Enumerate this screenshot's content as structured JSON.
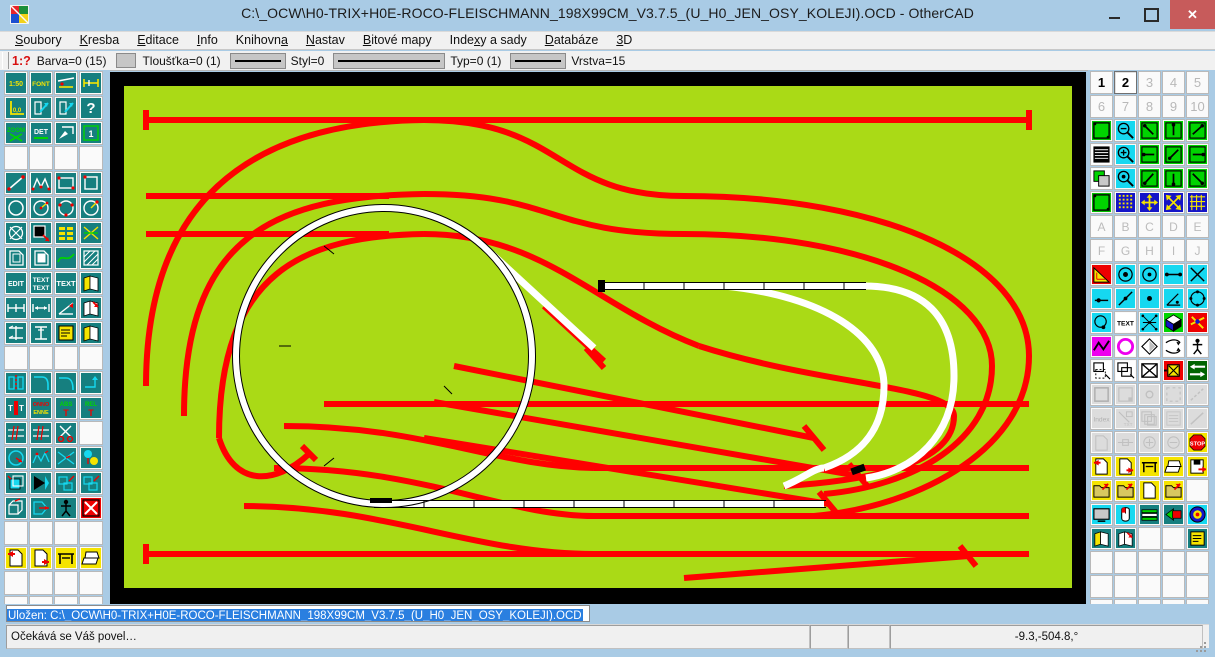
{
  "window": {
    "title": "C:\\_OCW\\H0-TRIX+H0E-ROCO-FLEISCHMANN_198X99CM_V3.7.5_(U_H0_JEN_OSY_KOLEJI).OCD - OtherCAD",
    "logo_icon": "othercad-logo-icon",
    "minimize_label": "–",
    "maximize_label": "□",
    "close_label": "✕"
  },
  "menu": {
    "items": [
      {
        "label": "Soubory",
        "mnemonic": "S"
      },
      {
        "label": "Kresba",
        "mnemonic": "K"
      },
      {
        "label": "Editace",
        "mnemonic": "E"
      },
      {
        "label": "Info",
        "mnemonic": "I"
      },
      {
        "label": "Knihovna",
        "mnemonic": "a"
      },
      {
        "label": "Nastav",
        "mnemonic": "N"
      },
      {
        "label": "Bitové mapy",
        "mnemonic": "B"
      },
      {
        "label": "Indexy a sady",
        "mnemonic": "x"
      },
      {
        "label": "Databáze",
        "mnemonic": "D"
      },
      {
        "label": "3D",
        "mnemonic": "3"
      }
    ]
  },
  "properties": {
    "ratio": "1:?",
    "color": "Barva=0 (15)",
    "color_swatch": "#c6c6c6",
    "thickness": "Tloušťka=0 (1)",
    "style": "Styl=0",
    "type": "Typ=0 (1)",
    "layer": "Vrstva=15"
  },
  "left_toolbar": {
    "rows": [
      [
        "scale-1-50-icon",
        "font-icon",
        "dimension-slope-icon",
        "dimension-linear-icon"
      ],
      [
        "origin-0-0-icon",
        "query-arrow-icon",
        "query-arrow-alt-icon",
        "question-mark-icon"
      ],
      [
        "zoom-icon",
        "detail-icon",
        "pick-entity-icon",
        "layer-1-icon"
      ],
      [
        "",
        "",
        "",
        ""
      ],
      [
        "line-icon",
        "polyline-icon",
        "rectangle-icon",
        "square-icon"
      ],
      [
        "circle-icon",
        "circle-radius-icon",
        "arc-3point-icon",
        "arc-center-icon"
      ],
      [
        "ellipse-icon",
        "filled-shape-icon",
        "table-icon",
        "spline-icon"
      ],
      [
        "copy-shape-icon",
        "offset-shape-icon",
        "curve-icon",
        "hatch-icon"
      ],
      [
        "edit-icon",
        "text-multi-icon",
        "text-icon",
        "book-icon"
      ],
      [
        "dim-horizontal-icon",
        "dim-baseline-icon",
        "dim-angular-icon",
        "book-red-icon"
      ],
      [
        "section-icon",
        "column-icon",
        "note-icon",
        "book-stack-icon"
      ],
      [
        "",
        "",
        "",
        ""
      ],
      [
        "mirror-icon",
        "fillet-icon",
        "chamfer-icon",
        "extend-icon"
      ],
      [
        "text-edit-icon",
        "rename-icon",
        "abs-coord-icon",
        "rel-coord-icon"
      ],
      [
        "break-icon",
        "trim-segment-icon",
        "scissors-icon",
        ""
      ],
      [
        "rotate-icon",
        "modify-vertex-icon",
        "intersect-icon",
        "node-color-icon"
      ],
      [
        "move-copy-icon",
        "fill-arrow-icon",
        "resize-icon",
        "scale-icon"
      ],
      [
        "3d-extrude-icon",
        "push-icon",
        "person-icon",
        "delete-x-icon"
      ],
      [
        "",
        "",
        "",
        ""
      ],
      [
        "import-icon",
        "export-icon",
        "plotter-icon",
        "printer-icon"
      ],
      [
        "",
        "",
        "",
        ""
      ],
      [
        "",
        "",
        "",
        ""
      ]
    ]
  },
  "right_toolbar": {
    "page_numbers_row1": [
      "1",
      "2",
      "3",
      "4",
      "5"
    ],
    "page_numbers_row2": [
      "6",
      "7",
      "8",
      "9",
      "10"
    ],
    "active_page": "2",
    "letters_row1": [
      "A",
      "B",
      "C",
      "D",
      "E"
    ],
    "letters_row2": [
      "F",
      "G",
      "H",
      "I",
      "J"
    ],
    "index_label": "Index",
    "stop_label": "STOP",
    "text_tile_label": "TEXT",
    "rows": [
      [
        "view-fit-icon",
        "zoom-out-icon",
        "pan-up-left-icon",
        "pan-up-icon",
        "pan-up-right-icon"
      ],
      [
        "layers-list-icon",
        "zoom-in-icon",
        "pan-left-icon",
        "zoom-window-icon",
        "pan-right-icon"
      ],
      [
        "layer-copy-icon",
        "zoom-point-icon",
        "pan-down-left-icon",
        "pan-down-icon",
        "pan-down-right-icon"
      ],
      [
        "view-all-icon",
        "grid-dots-icon",
        "move-cross-icon",
        "resize-diagonal-icon",
        "grid-lines-icon"
      ],
      [
        "triangle-ruler-icon",
        "snap-center-icon",
        "snap-node-icon",
        "snap-midpoint-icon",
        "snap-intersection-icon"
      ],
      [
        "snap-endpoint-icon",
        "snap-on-line-icon",
        "snap-point-icon",
        "snap-perpendicular-icon",
        "snap-circle-icon"
      ],
      [
        "snap-tangent-icon",
        "snap-text-icon",
        "snap-nearest-icon",
        "3d-cube-icon",
        "snap-off-icon"
      ],
      [
        "polyline-magenta-icon",
        "circle-magenta-icon",
        "mirror-shape-icon",
        "array-icon",
        "people-icon"
      ],
      [
        "move-dashed-icon",
        "copy-shape2-icon",
        "delete-cross-icon",
        "delete-selected-icon",
        "swap-arrows-icon"
      ],
      [
        "rect-gray-icon",
        "rect-corner-icon",
        "circle-gray-icon",
        "dashed-rect-icon",
        "line-gray-icon"
      ],
      [
        "index-icon",
        "rotate-text-icon",
        "layers-gray-icon",
        "list-gray-icon",
        "pen-gray-icon"
      ],
      [
        "page-gray-icon",
        "width-gray-icon",
        "plus-gray-icon",
        "minus-gray-icon",
        "stop-icon"
      ],
      [
        "import-icon",
        "export-icon",
        "plotter-icon",
        "printer-icon",
        "save-icon"
      ],
      [
        "folder-open-icon",
        "folder-save-icon",
        "new-file-icon",
        "folder-red-icon",
        ""
      ],
      [
        "screen-icon",
        "mouse-icon",
        "books-icon",
        "bookmark-icon",
        "target-icon"
      ],
      [
        "book-stack2-icon",
        "book-red2-icon",
        "",
        "",
        "note2-icon"
      ],
      [
        "",
        "",
        "",
        "",
        ""
      ],
      [
        "",
        "",
        "",
        "",
        ""
      ],
      [
        "",
        "",
        "",
        "",
        ""
      ]
    ]
  },
  "canvas": {
    "background": "#aada16",
    "border": "#000000",
    "track_red": "#ff0000",
    "track_white": "#ffffff"
  },
  "status": {
    "command_line": "Uložen: C:\\_OCW\\H0-TRIX+H0E-ROCO-FLEISCHMANN_198X99CM_V3.7.5_(U_H0_JEN_OSY_KOLEJI).OCD",
    "message": "Očekává se Váš povel…",
    "pane_a": "",
    "pane_b": "",
    "coordinates": "-9.3,-504.8,°"
  }
}
